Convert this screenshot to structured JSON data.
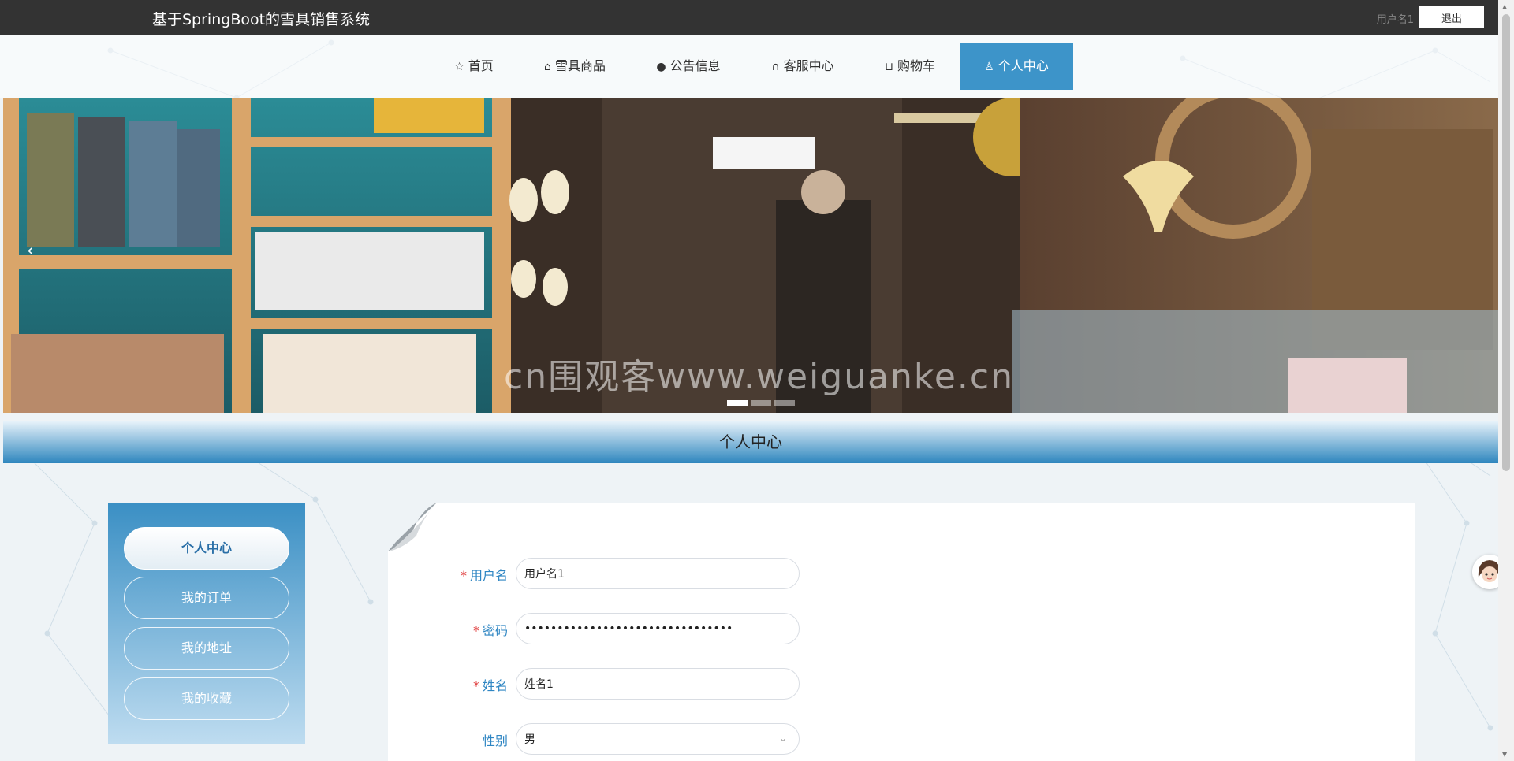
{
  "topbar": {
    "site_title": "基于SpringBoot的雪具销售系统",
    "user_name": "用户名1",
    "logout_label": "退出"
  },
  "nav": {
    "items": [
      {
        "label": "首页",
        "icon": "star-icon"
      },
      {
        "label": "雪具商品",
        "icon": "bag-icon"
      },
      {
        "label": "公告信息",
        "icon": "info-icon"
      },
      {
        "label": "客服中心",
        "icon": "headset-icon"
      },
      {
        "label": "购物车",
        "icon": "cart-icon"
      },
      {
        "label": "个人中心",
        "icon": "user-icon",
        "active": true
      }
    ]
  },
  "banner": {
    "watermark": "cn围观客www.weiguanke.cn",
    "prev_icon": "‹",
    "slide_count": 3,
    "active_slide": 1
  },
  "section": {
    "title": "个人中心"
  },
  "sidebar": {
    "items": [
      {
        "label": "个人中心",
        "active": true
      },
      {
        "label": "我的订单"
      },
      {
        "label": "我的地址"
      },
      {
        "label": "我的收藏"
      }
    ]
  },
  "form": {
    "required_mark": "*",
    "fields": [
      {
        "label": "用户名",
        "value": "用户名1",
        "required": true
      },
      {
        "label": "密码",
        "value": "••••••••••••••••••••••••••••••••",
        "required": true
      },
      {
        "label": "姓名",
        "value": "姓名1",
        "required": true
      },
      {
        "label": "性别",
        "value": "男",
        "required": false
      }
    ]
  },
  "colors": {
    "topbar": "#333333",
    "accent": "#3d94c9",
    "label": "#2f86c3",
    "required": "#e04040"
  }
}
